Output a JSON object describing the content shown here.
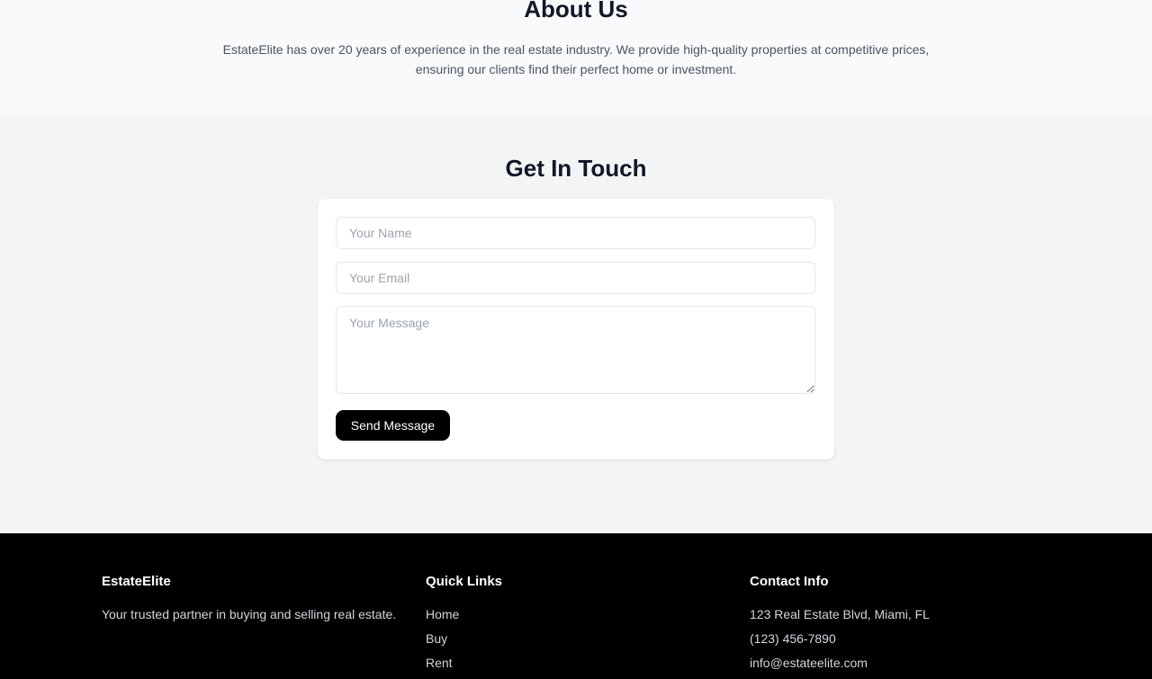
{
  "about": {
    "title": "About Us",
    "text": "EstateElite has over 20 years of experience in the real estate industry. We provide high-quality properties at competitive prices, ensuring our clients find their perfect home or investment."
  },
  "contact": {
    "title": "Get In Touch",
    "name_placeholder": "Your Name",
    "email_placeholder": "Your Email",
    "message_placeholder": "Your Message",
    "send_label": "Send Message"
  },
  "footer": {
    "brand": {
      "name": "EstateElite",
      "tagline": "Your trusted partner in buying and selling real estate."
    },
    "quick_links": {
      "heading": "Quick Links",
      "items": [
        "Home",
        "Buy",
        "Rent"
      ]
    },
    "contact_info": {
      "heading": "Contact Info",
      "address": "123 Real Estate Blvd, Miami, FL",
      "phone": "(123) 456-7890",
      "email": "info@estateelite.com"
    }
  },
  "colors": {
    "button_bg": "#000000",
    "footer_bg": "#000000",
    "section_bg": "#f3f4f6",
    "heading": "#111827"
  }
}
